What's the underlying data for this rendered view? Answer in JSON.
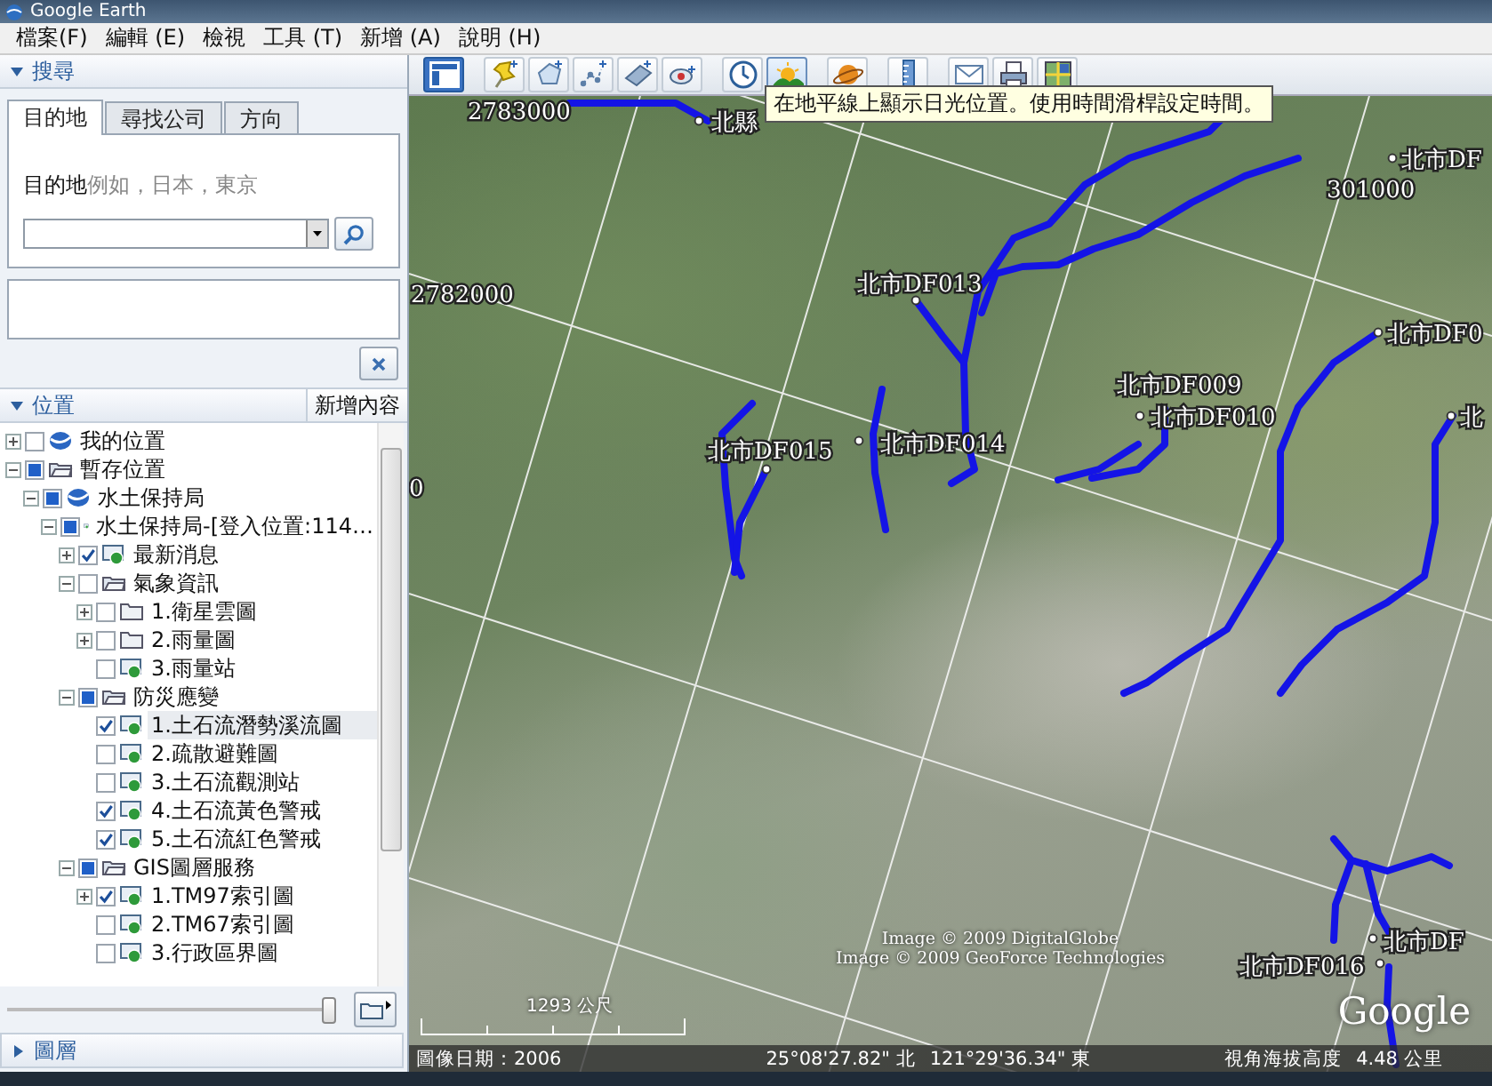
{
  "window": {
    "title": "Google Earth"
  },
  "menu": [
    "檔案(F)",
    "編輯 (E)",
    "檢視",
    "工具 (T)",
    "新增 (A)",
    "說明 (H)"
  ],
  "search": {
    "header": "搜尋",
    "expanded": true,
    "tabs": [
      {
        "label": "目的地",
        "selected": true
      },
      {
        "label": "尋找公司",
        "selected": false
      },
      {
        "label": "方向",
        "selected": false
      }
    ],
    "label": "目的地",
    "example": "例如，日本，東京"
  },
  "places": {
    "header": "位置",
    "expanded": true,
    "add_button": "新增內容",
    "tree": [
      {
        "label": "我的位置",
        "kind": "globe",
        "checked": false,
        "partial": false,
        "expanded": false,
        "selected": false
      },
      {
        "label": "暫存位置",
        "kind": "folder",
        "checked": false,
        "partial": true,
        "expanded": true,
        "selected": false,
        "children": [
          {
            "label": "水土保持局",
            "kind": "globe",
            "checked": false,
            "partial": true,
            "expanded": true,
            "selected": false,
            "children": [
              {
                "label": "水土保持局-[登入位置:114…",
                "kind": "link",
                "checked": false,
                "partial": true,
                "expanded": true,
                "selected": false,
                "children": [
                  {
                    "label": "最新消息",
                    "kind": "link",
                    "checked": true,
                    "expanded": false,
                    "selected": false
                  },
                  {
                    "label": "氣象資訊",
                    "kind": "folder",
                    "checked": false,
                    "partial": false,
                    "expanded": true,
                    "selected": false,
                    "children": [
                      {
                        "label": "1.衛星雲圖",
                        "kind": "closed-folder",
                        "checked": false,
                        "partial": false,
                        "expanded": false,
                        "selected": false
                      },
                      {
                        "label": "2.雨量圖",
                        "kind": "closed-folder",
                        "checked": false,
                        "partial": false,
                        "expanded": false,
                        "selected": false
                      },
                      {
                        "label": "3.雨量站",
                        "kind": "link",
                        "checked": false,
                        "partial": false,
                        "selected": false
                      }
                    ]
                  },
                  {
                    "label": "防災應變",
                    "kind": "folder",
                    "checked": false,
                    "partial": true,
                    "expanded": true,
                    "selected": false,
                    "children": [
                      {
                        "label": "1.土石流潛勢溪流圖",
                        "kind": "link",
                        "checked": true,
                        "selected": true
                      },
                      {
                        "label": "2.疏散避難圖",
                        "kind": "link",
                        "checked": false,
                        "partial": false,
                        "selected": false
                      },
                      {
                        "label": "3.土石流觀測站",
                        "kind": "link",
                        "checked": false,
                        "partial": false,
                        "selected": false
                      },
                      {
                        "label": "4.土石流黃色警戒",
                        "kind": "link",
                        "checked": true,
                        "selected": false
                      },
                      {
                        "label": "5.土石流紅色警戒",
                        "kind": "link",
                        "checked": true,
                        "selected": false
                      }
                    ]
                  },
                  {
                    "label": "GIS圖層服務",
                    "kind": "folder",
                    "checked": false,
                    "partial": true,
                    "expanded": true,
                    "selected": false,
                    "children": [
                      {
                        "label": "1.TM97索引圖",
                        "kind": "link",
                        "checked": true,
                        "expanded": false,
                        "selected": false
                      },
                      {
                        "label": "2.TM67索引圖",
                        "kind": "link",
                        "checked": false,
                        "partial": false,
                        "selected": false
                      },
                      {
                        "label": "3.行政區界圖",
                        "kind": "link",
                        "checked": false,
                        "partial": false,
                        "selected": false
                      }
                    ]
                  }
                ]
              }
            ]
          }
        ]
      }
    ],
    "slider": {
      "level": 1
    }
  },
  "layers": {
    "header": "圖層",
    "expanded": false
  },
  "toolbar": {
    "buttons": [
      {
        "kind": "sidebar",
        "selected": true,
        "hovered": false
      },
      {
        "kind": "placemark",
        "selected": false,
        "hovered": false
      },
      {
        "kind": "polygon",
        "selected": false,
        "hovered": false
      },
      {
        "kind": "path",
        "selected": false,
        "hovered": false
      },
      {
        "kind": "overlay",
        "selected": false,
        "hovered": false
      },
      {
        "kind": "tour",
        "selected": false,
        "hovered": false
      },
      {
        "kind": "time",
        "selected": false,
        "hovered": false
      },
      {
        "kind": "sun",
        "selected": false,
        "hovered": true
      },
      {
        "kind": "planet",
        "selected": false,
        "hovered": false
      },
      {
        "kind": "ruler",
        "selected": false,
        "hovered": false
      },
      {
        "kind": "email",
        "selected": false,
        "hovered": false
      },
      {
        "kind": "print",
        "selected": false,
        "hovered": false
      },
      {
        "kind": "mapview",
        "selected": false,
        "hovered": false
      }
    ]
  },
  "tooltip": "在地平線上顯示日光位置。使用時間滑桿設定時間。",
  "map": {
    "labels": [
      "2783000",
      "北縣",
      "301000",
      "北市DF",
      "2782000",
      "北市DF013",
      "北市DF0",
      "北市DF009",
      "北市DF010",
      "北市DF015",
      "北市DF014",
      "北",
      "0",
      "北市DF",
      "北市DF016"
    ],
    "attributions": [
      "Image © 2009 DigitalGlobe",
      "Image © 2009 GeoForce Technologies"
    ],
    "logo": "Google",
    "scale": "1293 公尺",
    "status": {
      "image_date": "圖像日期：2006",
      "latitude": "25°08'27.82\" 北",
      "longitude": "121°29'36.34\" 東",
      "altitude_label": "視角海拔高度",
      "altitude": "4.48 公里"
    }
  }
}
